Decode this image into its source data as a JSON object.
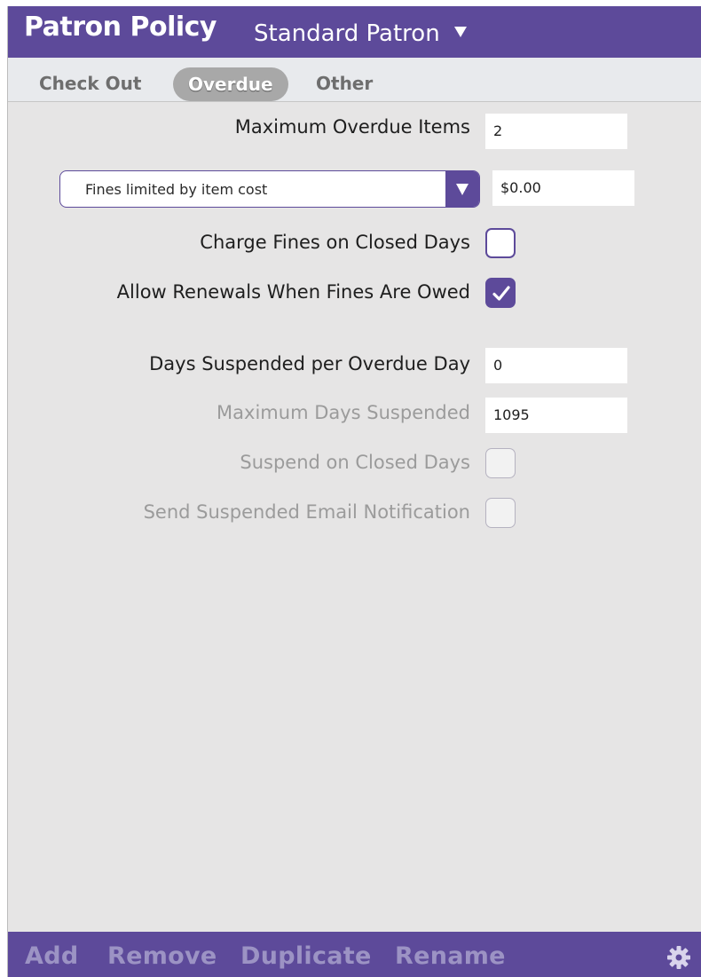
{
  "header": {
    "title": "Patron Policy",
    "policy_selector": "Standard Patron"
  },
  "tabs": [
    {
      "label": "Check Out",
      "active": false
    },
    {
      "label": "Overdue",
      "active": true
    },
    {
      "label": "Other",
      "active": false
    }
  ],
  "overdue": {
    "max_overdue_items": {
      "label": "Maximum Overdue Items",
      "value": "2"
    },
    "fines_mode": {
      "selected": "Fines limited by item cost",
      "amount": "$0.00"
    },
    "charge_fines_closed_days": {
      "label": "Charge Fines on Closed Days",
      "checked": false
    },
    "allow_renewals_fines_owed": {
      "label": "Allow Renewals When Fines Are Owed",
      "checked": true
    },
    "days_suspended_per_overdue_day": {
      "label": "Days Suspended per Overdue Day",
      "value": "0"
    },
    "max_days_suspended": {
      "label": "Maximum Days Suspended",
      "value": "1095",
      "enabled": false
    },
    "suspend_on_closed_days": {
      "label": "Suspend on Closed Days",
      "checked": false,
      "enabled": false
    },
    "send_suspended_email": {
      "label": "Send Suspended Email Notification",
      "checked": false,
      "enabled": false
    }
  },
  "footer": {
    "add": "Add",
    "remove": "Remove",
    "duplicate": "Duplicate",
    "rename": "Rename",
    "settings_icon": "gear-icon"
  },
  "colors": {
    "accent": "#5d4a9a",
    "panel_bg": "#e6e5e5",
    "tab_active": "#a8a8a8",
    "footer_text": "#9c93c4",
    "disabled_text": "#9b9b9b"
  }
}
